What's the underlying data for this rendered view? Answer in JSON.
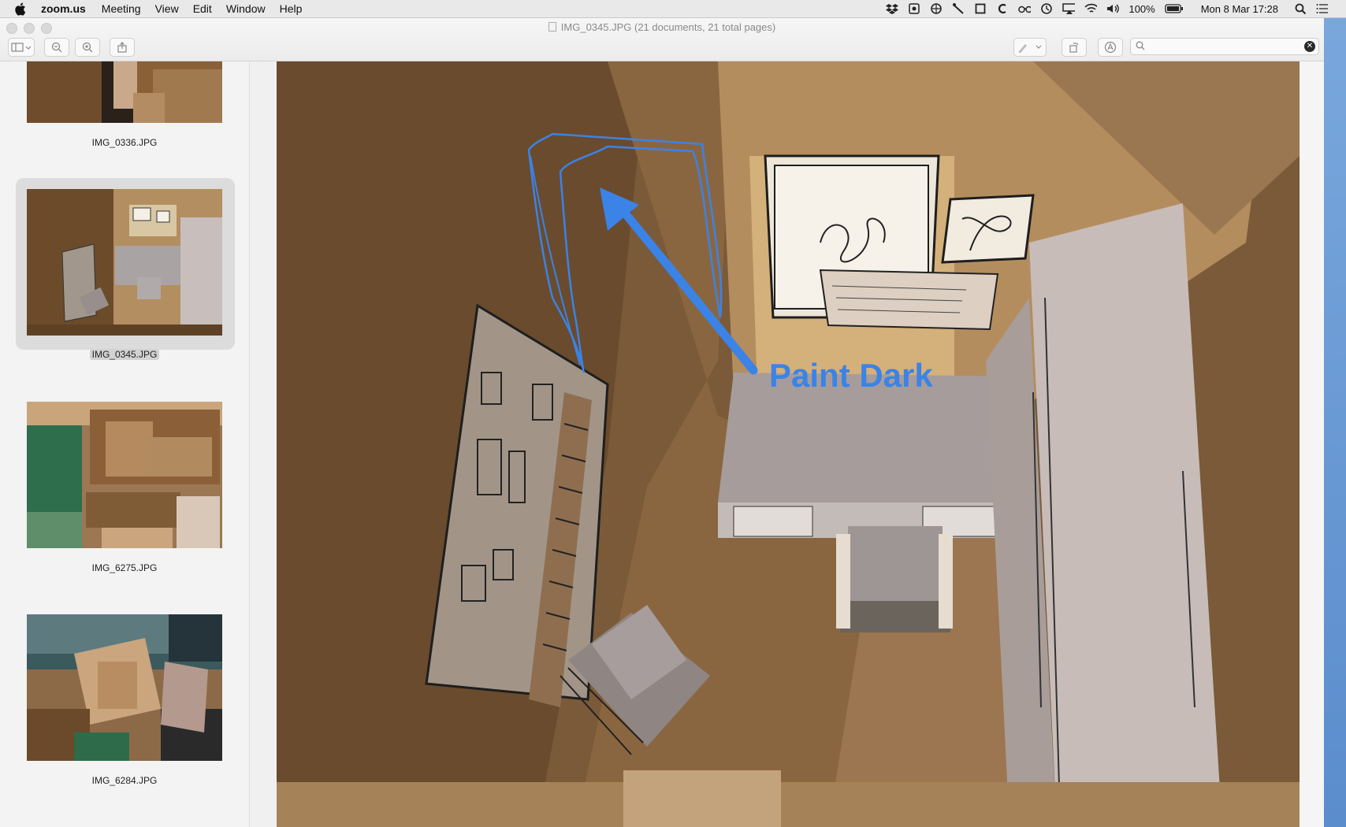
{
  "menubar": {
    "app_name": "zoom.us",
    "items": [
      "Meeting",
      "View",
      "Edit",
      "Window",
      "Help"
    ],
    "battery": "100%",
    "datetime": "Mon 8 Mar  17:28"
  },
  "window": {
    "title": "IMG_0345.JPG (21 documents, 21 total pages)"
  },
  "search": {
    "value": "",
    "placeholder": ""
  },
  "sidebar": {
    "items": [
      {
        "label": "IMG_0336.JPG",
        "selected": false
      },
      {
        "label": "IMG_0345.JPG",
        "selected": true
      },
      {
        "label": "IMG_6275.JPG",
        "selected": false
      },
      {
        "label": "IMG_6284.JPG",
        "selected": false
      }
    ]
  },
  "annotation": {
    "text": "Paint Dark",
    "color": "#3b83e6"
  },
  "colors": {
    "accent": "#3b83e6",
    "cardboard": "#b08a5c"
  }
}
